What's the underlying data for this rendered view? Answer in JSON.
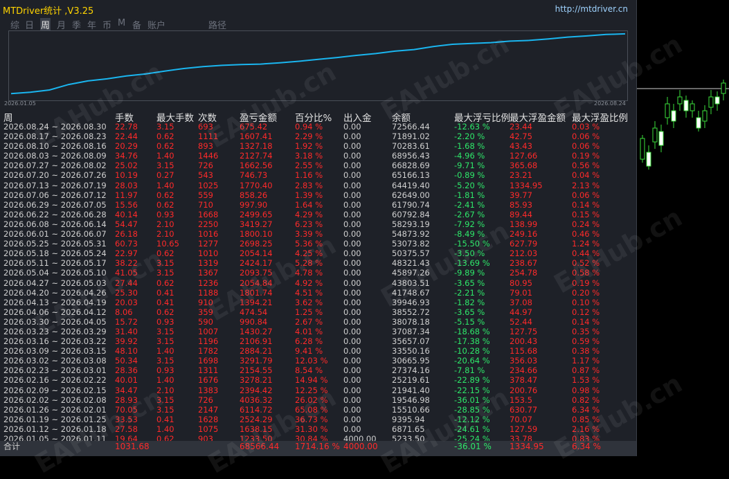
{
  "title": "MTDriver统计 ,V3.25",
  "site": "http://mtdriver.cn",
  "tabs": [
    "综",
    "日",
    "周",
    "月",
    "季",
    "年",
    "币",
    "M",
    "备",
    "账户",
    "路径"
  ],
  "active_tab": "周",
  "equity_axis": {
    "start": "2026.01.05",
    "end": "2026.08.24"
  },
  "equity_curve": [
    5233,
    6871,
    9395,
    15510,
    19546,
    21941,
    25219,
    27374,
    30665,
    33550,
    35657,
    37087,
    38078,
    38552,
    39946,
    41748,
    43803,
    45897,
    48321,
    50375,
    53073,
    54873,
    58293,
    60792,
    61790,
    62649,
    64419,
    65166,
    66828,
    68956,
    70283,
    71891,
    72566
  ],
  "headers": [
    "周",
    "手数",
    "最大手数",
    "次数",
    "盈亏金额",
    "百分比%",
    "出入金",
    "余额",
    "最大浮亏比例",
    "最大浮盈金额",
    "最大浮盈比例"
  ],
  "rows": [
    {
      "period": "2026.08.24 ~ 2026.08.30",
      "lots": "22.78",
      "max_lots": "3.15",
      "trades": "693",
      "pnl": "675.42",
      "pct": "0.94 %",
      "dep": "0.00",
      "bal": "72566.44",
      "fl": "-12.63 %",
      "fp": "23.44",
      "fpr": "0.03 %"
    },
    {
      "period": "2026.08.17 ~ 2026.08.23",
      "lots": "22.44",
      "max_lots": "0.62",
      "trades": "1111",
      "pnl": "1607.41",
      "pct": "2.29 %",
      "dep": "0.00",
      "bal": "71891.02",
      "fl": "-2.20 %",
      "fp": "42.75",
      "fpr": "0.06 %"
    },
    {
      "period": "2026.08.10 ~ 2026.08.16",
      "lots": "20.29",
      "max_lots": "0.62",
      "trades": "893",
      "pnl": "1327.18",
      "pct": "1.92 %",
      "dep": "0.00",
      "bal": "70283.61",
      "fl": "-1.68 %",
      "fp": "43.43",
      "fpr": "0.06 %"
    },
    {
      "period": "2026.08.03 ~ 2026.08.09",
      "lots": "34.76",
      "max_lots": "1.40",
      "trades": "1446",
      "pnl": "2127.74",
      "pct": "3.18 %",
      "dep": "0.00",
      "bal": "68956.43",
      "fl": "-4.96 %",
      "fp": "127.66",
      "fpr": "0.19 %"
    },
    {
      "period": "2026.07.27 ~ 2026.08.02",
      "lots": "25.02",
      "max_lots": "3.15",
      "trades": "726",
      "pnl": "1662.56",
      "pct": "2.55 %",
      "dep": "0.00",
      "bal": "66828.69",
      "fl": "-9.71 %",
      "fp": "365.68",
      "fpr": "0.56 %"
    },
    {
      "period": "2026.07.20 ~ 2026.07.26",
      "lots": "10.19",
      "max_lots": "0.27",
      "trades": "543",
      "pnl": "746.73",
      "pct": "1.16 %",
      "dep": "0.00",
      "bal": "65166.13",
      "fl": "-0.89 %",
      "fp": "23.21",
      "fpr": "0.04 %"
    },
    {
      "period": "2026.07.13 ~ 2026.07.19",
      "lots": "28.03",
      "max_lots": "1.40",
      "trades": "1025",
      "pnl": "1770.40",
      "pct": "2.83 %",
      "dep": "0.00",
      "bal": "64419.40",
      "fl": "-5.20 %",
      "fp": "1334.95",
      "fpr": "2.13 %"
    },
    {
      "period": "2026.07.06 ~ 2026.07.12",
      "lots": "11.97",
      "max_lots": "0.62",
      "trades": "559",
      "pnl": "858.26",
      "pct": "1.39 %",
      "dep": "0.00",
      "bal": "62649.00",
      "fl": "-1.81 %",
      "fp": "39.77",
      "fpr": "0.06 %"
    },
    {
      "period": "2026.06.29 ~ 2026.07.05",
      "lots": "15.56",
      "max_lots": "0.62",
      "trades": "710",
      "pnl": "997.90",
      "pct": "1.64 %",
      "dep": "0.00",
      "bal": "61790.74",
      "fl": "-2.41 %",
      "fp": "85.93",
      "fpr": "0.14 %"
    },
    {
      "period": "2026.06.22 ~ 2026.06.28",
      "lots": "40.14",
      "max_lots": "0.93",
      "trades": "1668",
      "pnl": "2499.65",
      "pct": "4.29 %",
      "dep": "0.00",
      "bal": "60792.84",
      "fl": "-2.67 %",
      "fp": "89.44",
      "fpr": "0.15 %"
    },
    {
      "period": "2026.06.08 ~ 2026.06.14",
      "lots": "54.47",
      "max_lots": "2.10",
      "trades": "2250",
      "pnl": "3419.27",
      "pct": "6.23 %",
      "dep": "0.00",
      "bal": "58293.19",
      "fl": "-7.92 %",
      "fp": "138.99",
      "fpr": "0.24 %"
    },
    {
      "period": "2026.06.01 ~ 2026.06.07",
      "lots": "26.18",
      "max_lots": "2.10",
      "trades": "1016",
      "pnl": "1800.10",
      "pct": "3.39 %",
      "dep": "0.00",
      "bal": "54873.92",
      "fl": "-8.49 %",
      "fp": "249.16",
      "fpr": "0.46 %"
    },
    {
      "period": "2026.05.25 ~ 2026.05.31",
      "lots": "60.73",
      "max_lots": "10.65",
      "trades": "1277",
      "pnl": "2698.25",
      "pct": "5.36 %",
      "dep": "0.00",
      "bal": "53073.82",
      "fl": "-15.50 %",
      "fp": "627.79",
      "fpr": "1.24 %"
    },
    {
      "period": "2026.05.18 ~ 2026.05.24",
      "lots": "22.97",
      "max_lots": "0.62",
      "trades": "1010",
      "pnl": "2054.14",
      "pct": "4.25 %",
      "dep": "0.00",
      "bal": "50375.57",
      "fl": "-3.50 %",
      "fp": "212.03",
      "fpr": "0.44 %"
    },
    {
      "period": "2026.05.11 ~ 2026.05.17",
      "lots": "38.22",
      "max_lots": "3.15",
      "trades": "1319",
      "pnl": "2424.17",
      "pct": "5.28 %",
      "dep": "0.00",
      "bal": "48321.43",
      "fl": "-13.69 %",
      "fp": "238.67",
      "fpr": "0.52 %"
    },
    {
      "period": "2026.05.04 ~ 2026.05.10",
      "lots": "41.05",
      "max_lots": "3.15",
      "trades": "1367",
      "pnl": "2093.75",
      "pct": "4.78 %",
      "dep": "0.00",
      "bal": "45897.26",
      "fl": "-9.89 %",
      "fp": "254.78",
      "fpr": "0.58 %"
    },
    {
      "period": "2026.04.27 ~ 2026.05.03",
      "lots": "27.44",
      "max_lots": "0.62",
      "trades": "1236",
      "pnl": "2054.84",
      "pct": "4.92 %",
      "dep": "0.00",
      "bal": "43803.51",
      "fl": "-3.65 %",
      "fp": "80.95",
      "fpr": "0.19 %"
    },
    {
      "period": "2026.04.20 ~ 2026.04.26",
      "lots": "25.30",
      "max_lots": "0.41",
      "trades": "1188",
      "pnl": "1801.74",
      "pct": "4.51 %",
      "dep": "0.00",
      "bal": "41748.67",
      "fl": "-2.21 %",
      "fp": "79.01",
      "fpr": "0.20 %"
    },
    {
      "period": "2026.04.13 ~ 2026.04.19",
      "lots": "20.03",
      "max_lots": "0.41",
      "trades": "910",
      "pnl": "1394.21",
      "pct": "3.62 %",
      "dep": "0.00",
      "bal": "39946.93",
      "fl": "-1.82 %",
      "fp": "37.08",
      "fpr": "0.10 %"
    },
    {
      "period": "2026.04.06 ~ 2026.04.12",
      "lots": "8.06",
      "max_lots": "0.62",
      "trades": "359",
      "pnl": "474.54",
      "pct": "1.25 %",
      "dep": "0.00",
      "bal": "38552.72",
      "fl": "-3.65 %",
      "fp": "44.97",
      "fpr": "0.12 %"
    },
    {
      "period": "2026.03.30 ~ 2026.04.05",
      "lots": "15.72",
      "max_lots": "0.93",
      "trades": "590",
      "pnl": "990.84",
      "pct": "2.67 %",
      "dep": "0.00",
      "bal": "38078.18",
      "fl": "-5.15 %",
      "fp": "52.44",
      "fpr": "0.14 %"
    },
    {
      "period": "2026.03.23 ~ 2026.03.29",
      "lots": "31.40",
      "max_lots": "3.15",
      "trades": "1007",
      "pnl": "1430.27",
      "pct": "4.01 %",
      "dep": "0.00",
      "bal": "37087.34",
      "fl": "-18.68 %",
      "fp": "127.75",
      "fpr": "0.35 %"
    },
    {
      "period": "2026.03.16 ~ 2026.03.22",
      "lots": "39.92",
      "max_lots": "3.15",
      "trades": "1196",
      "pnl": "2106.91",
      "pct": "6.28 %",
      "dep": "0.00",
      "bal": "35657.07",
      "fl": "-17.38 %",
      "fp": "200.43",
      "fpr": "0.59 %"
    },
    {
      "period": "2026.03.09 ~ 2026.03.15",
      "lots": "48.10",
      "max_lots": "1.40",
      "trades": "1782",
      "pnl": "2884.21",
      "pct": "9.41 %",
      "dep": "0.00",
      "bal": "33550.16",
      "fl": "-10.28 %",
      "fp": "115.68",
      "fpr": "0.38 %"
    },
    {
      "period": "2026.03.02 ~ 2026.03.08",
      "lots": "50.34",
      "max_lots": "3.15",
      "trades": "1698",
      "pnl": "3291.79",
      "pct": "12.03 %",
      "dep": "0.00",
      "bal": "30665.95",
      "fl": "-20.64 %",
      "fp": "356.03",
      "fpr": "1.17 %"
    },
    {
      "period": "2026.02.23 ~ 2026.03.01",
      "lots": "28.36",
      "max_lots": "0.93",
      "trades": "1311",
      "pnl": "2154.55",
      "pct": "8.54 %",
      "dep": "0.00",
      "bal": "27374.16",
      "fl": "-7.81 %",
      "fp": "234.66",
      "fpr": "0.87 %"
    },
    {
      "period": "2026.02.16 ~ 2026.02.22",
      "lots": "40.01",
      "max_lots": "1.40",
      "trades": "1676",
      "pnl": "3278.21",
      "pct": "14.94 %",
      "dep": "0.00",
      "bal": "25219.61",
      "fl": "-22.89 %",
      "fp": "378.47",
      "fpr": "1.53 %"
    },
    {
      "period": "2026.02.09 ~ 2026.02.15",
      "lots": "34.47",
      "max_lots": "2.10",
      "trades": "1383",
      "pnl": "2394.42",
      "pct": "12.25 %",
      "dep": "0.00",
      "bal": "21941.40",
      "fl": "-22.15 %",
      "fp": "200.76",
      "fpr": "0.98 %"
    },
    {
      "period": "2026.02.02 ~ 2026.02.08",
      "lots": "28.93",
      "max_lots": "3.15",
      "trades": "726",
      "pnl": "4036.32",
      "pct": "26.02 %",
      "dep": "0.00",
      "bal": "19546.98",
      "fl": "-36.01 %",
      "fp": "153.5",
      "fpr": "0.82 %"
    },
    {
      "period": "2026.01.26 ~ 2026.02.01",
      "lots": "70.05",
      "max_lots": "3.15",
      "trades": "2147",
      "pnl": "6114.72",
      "pct": "65.08 %",
      "dep": "0.00",
      "bal": "15510.66",
      "fl": "-28.85 %",
      "fp": "630.77",
      "fpr": "6.34 %"
    },
    {
      "period": "2026.01.19 ~ 2026.01.25",
      "lots": "33.53",
      "max_lots": "0.41",
      "trades": "1628",
      "pnl": "2524.29",
      "pct": "36.73 %",
      "dep": "0.00",
      "bal": "9395.94",
      "fl": "-12.12 %",
      "fp": "70.07",
      "fpr": "0.85 %"
    },
    {
      "period": "2026.01.12 ~ 2026.01.18",
      "lots": "27.58",
      "max_lots": "1.40",
      "trades": "1075",
      "pnl": "1638.15",
      "pct": "31.30 %",
      "dep": "0.00",
      "bal": "6871.65",
      "fl": "-24.61 %",
      "fp": "127.59",
      "fpr": "2.16 %"
    },
    {
      "period": "2026.01.05 ~ 2026.01.11",
      "lots": "19.64",
      "max_lots": "0.62",
      "trades": "903",
      "pnl": "1233.50",
      "pct": "30.84 %",
      "dep": "4000.00",
      "bal": "5233.50",
      "fl": "-25.24 %",
      "fp": "33.78",
      "fpr": "0.83 %"
    }
  ],
  "total": {
    "label": "合计",
    "lots": "1031.68",
    "pnl": "68566.44",
    "pct": "1714.16 %",
    "dep": "4000.00",
    "fl": "-36.01 %",
    "fp": "1334.95",
    "fpr": "6.34 %"
  },
  "watermark": "EAHub.cn",
  "colors": {
    "panel": "#1e2128",
    "title": "#ffd400",
    "loss": "#ff2a2a",
    "gain": "#2ee86a",
    "equity_line": "#1ab6f0"
  }
}
